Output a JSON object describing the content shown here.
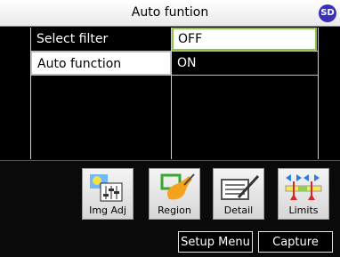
{
  "header": {
    "title": "Auto funtion",
    "sd_badge": "SD"
  },
  "settings": [
    {
      "label": "Select filter",
      "value": "OFF"
    },
    {
      "label": "Auto function",
      "value": "ON"
    }
  ],
  "toolbar": {
    "tools": [
      {
        "label": "Img Adj",
        "icon": "image-adjust-icon"
      },
      {
        "label": "Region",
        "icon": "region-icon"
      },
      {
        "label": "Detail",
        "icon": "detail-icon"
      },
      {
        "label": "Limits",
        "icon": "limits-icon"
      }
    ],
    "setup_label": "Setup Menu",
    "capture_label": "Capture"
  },
  "colors": {
    "accent_green": "#8ec34a",
    "sd_blue": "#3a2fb8"
  }
}
